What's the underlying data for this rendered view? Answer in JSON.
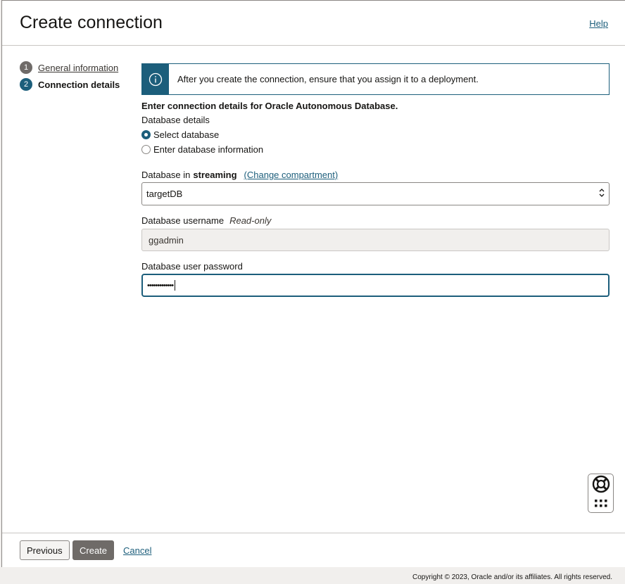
{
  "header": {
    "title": "Create connection",
    "help": "Help"
  },
  "steps": [
    {
      "num": "1",
      "label": "General information"
    },
    {
      "num": "2",
      "label": "Connection details"
    }
  ],
  "notice": {
    "text": "After you create the connection, ensure that you assign it to a deployment."
  },
  "form": {
    "section_title": "Enter connection details for Oracle Autonomous Database.",
    "db_details_label": "Database details",
    "radio_select": "Select database",
    "radio_enter": "Enter database information",
    "db_in_label": "Database in",
    "compartment": "streaming",
    "change_compartment": "(Change compartment)",
    "db_selected": "targetDB",
    "username_label": "Database username",
    "read_only": "Read-only",
    "username_value": "ggadmin",
    "password_label": "Database user password",
    "password_value": "•••••••••••••"
  },
  "footer": {
    "previous": "Previous",
    "create": "Create",
    "cancel": "Cancel"
  },
  "copyright": "Copyright © 2023, Oracle and/or its affiliates. All rights reserved.",
  "colors": {
    "accent": "#1c5e7b",
    "button_dark": "#6f6b68"
  }
}
